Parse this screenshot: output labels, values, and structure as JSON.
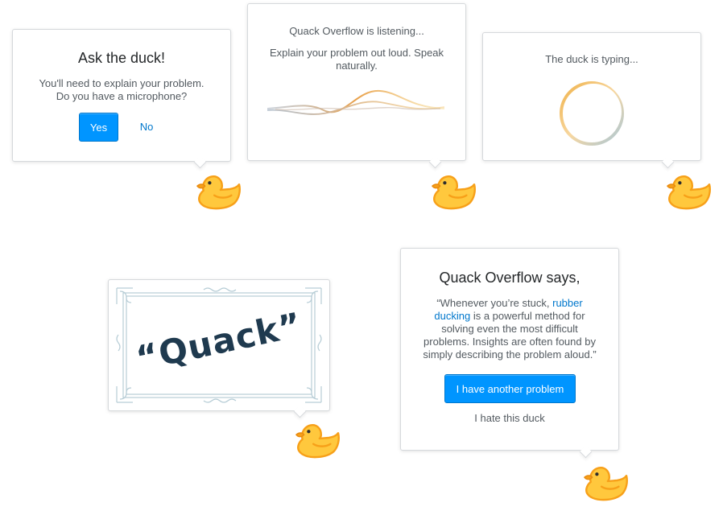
{
  "ask_card": {
    "title": "Ask the duck!",
    "line1": "You'll need to explain your problem.",
    "line2": "Do you have a microphone?",
    "yes_label": "Yes",
    "no_label": "No"
  },
  "listening_card": {
    "title": "Quack Overflow is listening...",
    "line1": "Explain your problem out loud. Speak",
    "line2": "naturally."
  },
  "typing_card": {
    "title": "The duck is typing..."
  },
  "quack_card": {
    "quack_text": "“Quack”"
  },
  "says_card": {
    "title": "Quack Overflow says,",
    "quote_line1": "“Whenever you’re stuck,",
    "link_part1": "rubber",
    "link_part2": "ducking",
    "quote_line2_rest": "is a powerful method for",
    "quote_line3": "solving even the most difficult",
    "quote_line4": "problems. Insights are often found by",
    "quote_line5": "simply describing the problem aloud.”",
    "primary_button": "I have another problem",
    "secondary_link": "I hate this duck"
  },
  "colors": {
    "primary_button": "#0095ff",
    "link": "#0077cc",
    "duck_yellow": "#ffc83d",
    "duck_orange": "#f7a019",
    "quack_text": "#1f3a4f",
    "frame": "#b7cdd6"
  },
  "icons": [
    "rubber-duck-icon",
    "sound-wave",
    "loading-ring",
    "ornate-frame"
  ]
}
